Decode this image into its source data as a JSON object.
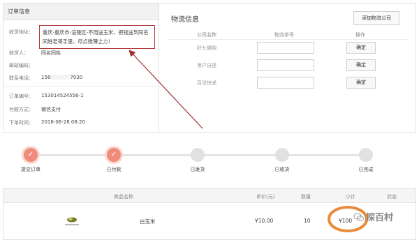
{
  "order_info": {
    "title": "订单信息",
    "address_label": "收货地址：",
    "address_value": "重庆-重庆市-涪陵区-不用送玉米，把钱送到同名同姓老哥手里，尽点微薄之力！",
    "receiver_label": "收货人：",
    "receiver_value": "同名同姓",
    "postcode_label": "邮政编码：",
    "postcode_value": "",
    "phone_label": "联系电话：",
    "phone_prefix": "158",
    "phone_suffix": "7030",
    "order_no_label": "订单编号：",
    "order_no_value": "153014524556-1",
    "payment_label": "付款方式：",
    "payment_value": "微信支付",
    "order_time_label": "下单时间：",
    "order_time_value": "2018-06-28 08:20"
  },
  "logistics": {
    "title": "物流信息",
    "add_company_button": "添加物流公司",
    "col_company": "公司名称",
    "col_tracking": "物流单号",
    "col_action": "操作",
    "rows": [
      {
        "company": "好七微购",
        "tracking": "",
        "action": "确定"
      },
      {
        "company": "用户自提",
        "tracking": "",
        "action": "确定"
      },
      {
        "company": "百世快递",
        "tracking": "",
        "action": "确定"
      }
    ]
  },
  "progress": {
    "steps": [
      {
        "label": "提交订单",
        "done": true
      },
      {
        "label": "已付款",
        "done": true
      },
      {
        "label": "已发货",
        "done": false
      },
      {
        "label": "已收货",
        "done": false
      },
      {
        "label": "已完成",
        "done": false
      }
    ]
  },
  "goods": {
    "headers": {
      "name": "商品名称",
      "price": "单价(元)",
      "qty": "数量",
      "subtotal": "小计",
      "status": "状态"
    },
    "rows": [
      {
        "name": "白玉米",
        "price": "¥10.00",
        "qty": "10",
        "subtotal": "¥100"
      }
    ]
  },
  "watermark": "探百村",
  "colors": {
    "annotation_red": "#b33a3a",
    "annotation_orange": "#e98b3a",
    "step_done": "#ef8b7a"
  }
}
